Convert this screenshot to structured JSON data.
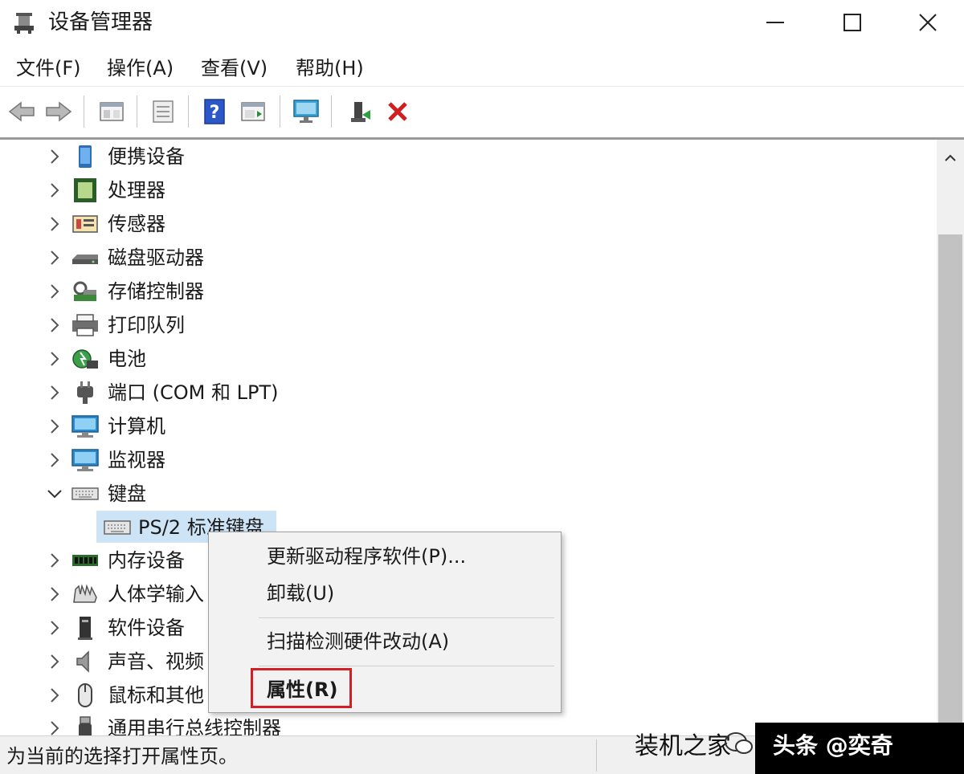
{
  "window": {
    "title": "设备管理器"
  },
  "menu": [
    "文件(F)",
    "操作(A)",
    "查看(V)",
    "帮助(H)"
  ],
  "toolbar": {
    "icons": [
      "back-arrow-icon",
      "forward-arrow-icon",
      "show-hide-tree-icon",
      "properties-sheet-icon",
      "help-icon",
      "action-pane-icon",
      "monitor-scan-icon",
      "update-driver-icon",
      "uninstall-icon"
    ]
  },
  "tree": {
    "rows": [
      {
        "label": "便携设备",
        "icon": "portable-device-icon",
        "expanded": false
      },
      {
        "label": "处理器",
        "icon": "processor-icon",
        "expanded": false
      },
      {
        "label": "传感器",
        "icon": "sensor-icon",
        "expanded": false
      },
      {
        "label": "磁盘驱动器",
        "icon": "disk-drive-icon",
        "expanded": false
      },
      {
        "label": "存储控制器",
        "icon": "storage-controller-icon",
        "expanded": false
      },
      {
        "label": "打印队列",
        "icon": "printer-icon",
        "expanded": false
      },
      {
        "label": "电池",
        "icon": "battery-icon",
        "expanded": false
      },
      {
        "label": "端口 (COM 和 LPT)",
        "icon": "port-icon",
        "expanded": false
      },
      {
        "label": "计算机",
        "icon": "computer-icon",
        "expanded": false
      },
      {
        "label": "监视器",
        "icon": "monitor-icon",
        "expanded": false
      },
      {
        "label": "键盘",
        "icon": "keyboard-icon",
        "expanded": true
      },
      {
        "label": "PS/2 标准键盘",
        "icon": "keyboard-icon",
        "child": true,
        "selected": true
      },
      {
        "label": "内存设备",
        "icon": "memory-icon",
        "expanded": false
      },
      {
        "label": "人体学输入",
        "icon": "hid-icon",
        "expanded": false
      },
      {
        "label": "软件设备",
        "icon": "software-device-icon",
        "expanded": false
      },
      {
        "label": "声音、视频",
        "icon": "speaker-icon",
        "expanded": false
      },
      {
        "label": "鼠标和其他",
        "icon": "mouse-icon",
        "expanded": false
      },
      {
        "label": "通用串行总线控制器",
        "icon": "usb-icon",
        "expanded": false
      }
    ]
  },
  "context_menu": {
    "items": [
      "更新驱动程序软件(P)...",
      "卸载(U)",
      "扫描检测硬件改动(A)",
      "属性(R)"
    ],
    "highlight_color": "#d21f26"
  },
  "status": {
    "text": "为当前的选择打开属性页。"
  },
  "watermark": {
    "left": "装机之家",
    "right": "头条 @奕奇"
  },
  "colors": {
    "selection": "#cde4f7",
    "uninstall_red": "#d11f1f",
    "help_blue": "#2c57c8"
  }
}
